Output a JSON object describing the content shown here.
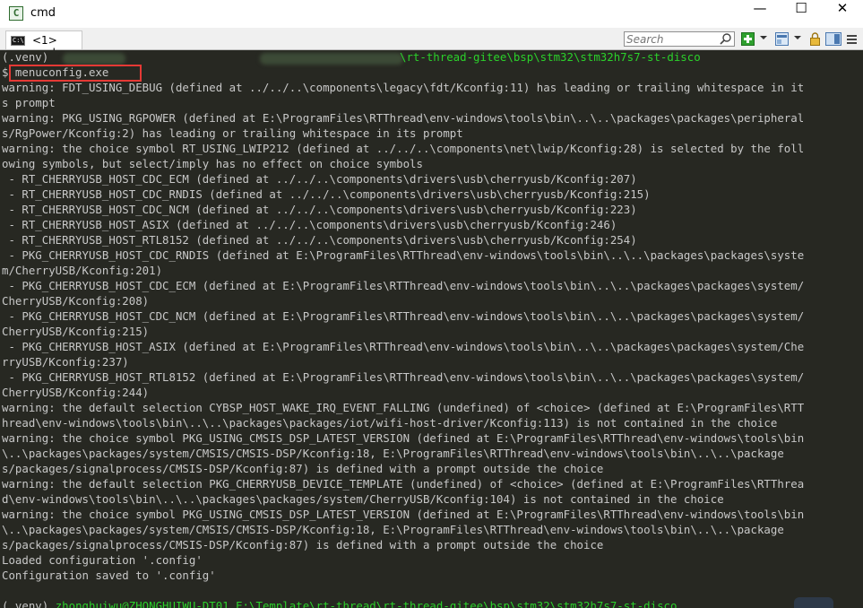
{
  "window": {
    "title": "cmd",
    "app_icon_char": "C",
    "controls": {
      "minimize": "—",
      "maximize": "☐",
      "close": "✕"
    }
  },
  "tab": {
    "label": "<1> cmd",
    "icon_text": "C:\\"
  },
  "search": {
    "placeholder": "Search"
  },
  "colors": {
    "console_bg": "#272822",
    "console_fg": "#c8c8c8",
    "prompt_green": "#2bd12b",
    "highlight": "#e53935"
  },
  "console": {
    "lines": [
      {
        "type": "prompt",
        "pre": "(.venv) ",
        "path": "\\rt-thread-gitee\\bsp\\stm32\\stm32h7s7-st-disco"
      },
      {
        "type": "text",
        "text": "$ menuconfig.exe"
      },
      {
        "type": "text",
        "text": "warning: FDT_USING_DEBUG (defined at ../../..\\components\\legacy\\fdt/Kconfig:11) has leading or trailing whitespace in it"
      },
      {
        "type": "text",
        "text": "s prompt"
      },
      {
        "type": "text",
        "text": "warning: PKG_USING_RGPOWER (defined at E:\\ProgramFiles\\RTThread\\env-windows\\tools\\bin\\..\\..\\packages\\packages\\peripheral"
      },
      {
        "type": "text",
        "text": "s/RgPower/Kconfig:2) has leading or trailing whitespace in its prompt"
      },
      {
        "type": "text",
        "text": "warning: the choice symbol RT_USING_LWIP212 (defined at ../../..\\components\\net\\lwip/Kconfig:28) is selected by the foll"
      },
      {
        "type": "text",
        "text": "owing symbols, but select/imply has no effect on choice symbols"
      },
      {
        "type": "text",
        "text": " - RT_CHERRYUSB_HOST_CDC_ECM (defined at ../../..\\components\\drivers\\usb\\cherryusb/Kconfig:207)"
      },
      {
        "type": "text",
        "text": " - RT_CHERRYUSB_HOST_CDC_RNDIS (defined at ../../..\\components\\drivers\\usb\\cherryusb/Kconfig:215)"
      },
      {
        "type": "text",
        "text": " - RT_CHERRYUSB_HOST_CDC_NCM (defined at ../../..\\components\\drivers\\usb\\cherryusb/Kconfig:223)"
      },
      {
        "type": "text",
        "text": " - RT_CHERRYUSB_HOST_ASIX (defined at ../../..\\components\\drivers\\usb\\cherryusb/Kconfig:246)"
      },
      {
        "type": "text",
        "text": " - RT_CHERRYUSB_HOST_RTL8152 (defined at ../../..\\components\\drivers\\usb\\cherryusb/Kconfig:254)"
      },
      {
        "type": "text",
        "text": " - PKG_CHERRYUSB_HOST_CDC_RNDIS (defined at E:\\ProgramFiles\\RTThread\\env-windows\\tools\\bin\\..\\..\\packages\\packages\\syste"
      },
      {
        "type": "text",
        "text": "m/CherryUSB/Kconfig:201)"
      },
      {
        "type": "text",
        "text": " - PKG_CHERRYUSB_HOST_CDC_ECM (defined at E:\\ProgramFiles\\RTThread\\env-windows\\tools\\bin\\..\\..\\packages\\packages\\system/"
      },
      {
        "type": "text",
        "text": "CherryUSB/Kconfig:208)"
      },
      {
        "type": "text",
        "text": " - PKG_CHERRYUSB_HOST_CDC_NCM (defined at E:\\ProgramFiles\\RTThread\\env-windows\\tools\\bin\\..\\..\\packages\\packages\\system/"
      },
      {
        "type": "text",
        "text": "CherryUSB/Kconfig:215)"
      },
      {
        "type": "text",
        "text": " - PKG_CHERRYUSB_HOST_ASIX (defined at E:\\ProgramFiles\\RTThread\\env-windows\\tools\\bin\\..\\..\\packages\\packages\\system/Che"
      },
      {
        "type": "text",
        "text": "rryUSB/Kconfig:237)"
      },
      {
        "type": "text",
        "text": " - PKG_CHERRYUSB_HOST_RTL8152 (defined at E:\\ProgramFiles\\RTThread\\env-windows\\tools\\bin\\..\\..\\packages\\packages\\system/"
      },
      {
        "type": "text",
        "text": "CherryUSB/Kconfig:244)"
      },
      {
        "type": "text",
        "text": "warning: the default selection CYBSP_HOST_WAKE_IRQ_EVENT_FALLING (undefined) of <choice> (defined at E:\\ProgramFiles\\RTT"
      },
      {
        "type": "text",
        "text": "hread\\env-windows\\tools\\bin\\..\\..\\packages\\packages/iot/wifi-host-driver/Kconfig:113) is not contained in the choice"
      },
      {
        "type": "text",
        "text": "warning: the choice symbol PKG_USING_CMSIS_DSP_LATEST_VERSION (defined at E:\\ProgramFiles\\RTThread\\env-windows\\tools\\bin"
      },
      {
        "type": "text",
        "text": "\\..\\packages\\packages/system/CMSIS/CMSIS-DSP/Kconfig:18, E:\\ProgramFiles\\RTThread\\env-windows\\tools\\bin\\..\\..\\package"
      },
      {
        "type": "text",
        "text": "s/packages/signalprocess/CMSIS-DSP/Kconfig:87) is defined with a prompt outside the choice"
      },
      {
        "type": "text",
        "text": "warning: the default selection PKG_CHERRYUSB_DEVICE_TEMPLATE (undefined) of <choice> (defined at E:\\ProgramFiles\\RTThrea"
      },
      {
        "type": "text",
        "text": "d\\env-windows\\tools\\bin\\..\\..\\packages\\packages/system/CherryUSB/Kconfig:104) is not contained in the choice"
      },
      {
        "type": "text",
        "text": "warning: the choice symbol PKG_USING_CMSIS_DSP_LATEST_VERSION (defined at E:\\ProgramFiles\\RTThread\\env-windows\\tools\\bin"
      },
      {
        "type": "text",
        "text": "\\..\\packages\\packages/system/CMSIS/CMSIS-DSP/Kconfig:18, E:\\ProgramFiles\\RTThread\\env-windows\\tools\\bin\\..\\..\\package"
      },
      {
        "type": "text",
        "text": "s/packages/signalprocess/CMSIS-DSP/Kconfig:87) is defined with a prompt outside the choice"
      },
      {
        "type": "text",
        "text": "Loaded configuration '.config'"
      },
      {
        "type": "text",
        "text": "Configuration saved to '.config'"
      },
      {
        "type": "text",
        "text": ""
      },
      {
        "type": "prompt",
        "pre": "(.venv) ",
        "path": "zhonghuiwu@ZHONGHUIWU-DT01 E:\\Template\\rt-thread\\rt-thread-gitee\\bsp\\stm32\\stm32h7s7-st-disco"
      }
    ]
  }
}
